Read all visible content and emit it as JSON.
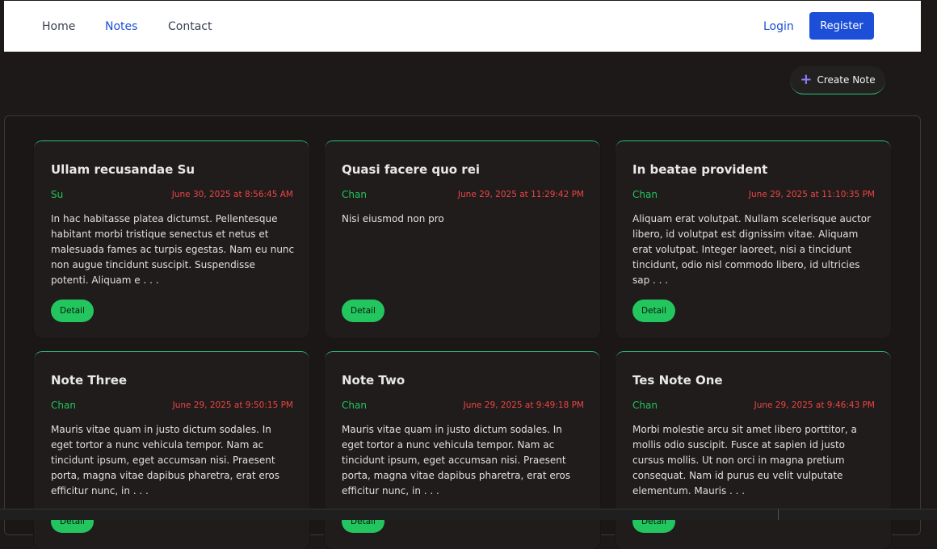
{
  "nav": {
    "links": [
      "Home",
      "Notes",
      "Contact"
    ],
    "login": "Login",
    "register": "Register"
  },
  "toolbar": {
    "create_label": "Create Note"
  },
  "notes": [
    {
      "title": "Ullam recusandae Su",
      "author": "Su",
      "date": "June 30, 2025 at 8:56:45 AM",
      "body": "In hac habitasse platea dictumst. Pellentesque habitant morbi tristique senectus et netus et malesuada fames ac turpis egestas. Nam eu nunc non augue tincidunt suscipit. Suspendisse potenti. Aliquam e . . .",
      "button": "Detail"
    },
    {
      "title": "Quasi facere quo rei",
      "author": "Chan",
      "date": "June 29, 2025 at 11:29:42 PM",
      "body": "Nisi eiusmod non pro",
      "button": "Detail"
    },
    {
      "title": "In beatae provident",
      "author": "Chan",
      "date": "June 29, 2025 at 11:10:35 PM",
      "body": "Aliquam erat volutpat. Nullam scelerisque auctor libero, id volutpat est dignissim vitae. Aliquam erat volutpat. Integer laoreet, nisi a tincidunt tincidunt, odio nisl commodo libero, id ultricies sap . . .",
      "button": "Detail"
    },
    {
      "title": "Note Three",
      "author": "Chan",
      "date": "June 29, 2025 at 9:50:15 PM",
      "body": "Mauris vitae quam in justo dictum sodales. In eget tortor a nunc vehicula tempor. Nam ac tincidunt ipsum, eget accumsan nisi. Praesent porta, magna vitae dapibus pharetra, erat eros efficitur nunc, in . . .",
      "button": "Detail"
    },
    {
      "title": "Note Two",
      "author": "Chan",
      "date": "June 29, 2025 at 9:49:18 PM",
      "body": "Mauris vitae quam in justo dictum sodales. In eget tortor a nunc vehicula tempor. Nam ac tincidunt ipsum, eget accumsan nisi. Praesent porta, magna vitae dapibus pharetra, erat eros efficitur nunc, in . . .",
      "button": "Detail"
    },
    {
      "title": "Tes Note One",
      "author": "Chan",
      "date": "June 29, 2025 at 9:46:43 PM",
      "body": "Morbi molestie arcu sit amet libero porttitor, a mollis odio suscipit. Fusce at sapien id justo cursus mollis. Ut non orci in magna pretium consequat. Nam id purus eu velit vulputate elementum. Mauris . . .",
      "button": "Detail"
    }
  ],
  "colors": {
    "accent": "#1d4ed8",
    "author": "#22c55e",
    "date": "#ef4444",
    "detail": "#22c55e",
    "background": "#1c1918"
  }
}
